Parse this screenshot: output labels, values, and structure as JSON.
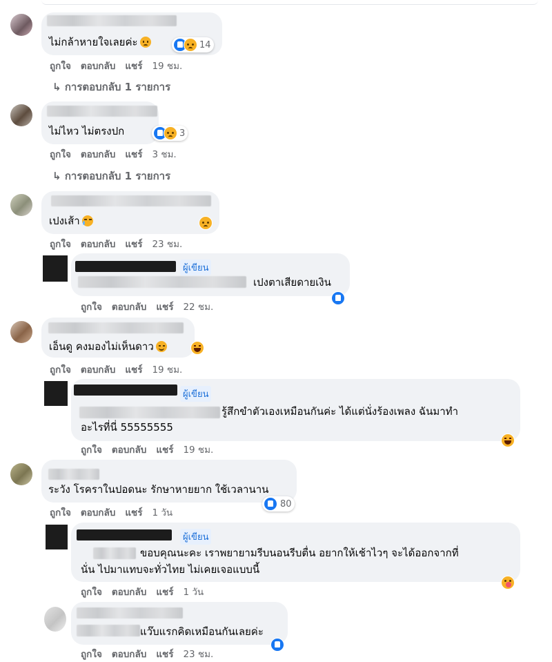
{
  "actions": {
    "like": "ถูกใจ",
    "reply": "ตอบกลับ",
    "share": "แชร์"
  },
  "author_tag": "ผู้เขียน",
  "comments": [
    {
      "text": "ไม่กล้าหายใจเลยค่ะ",
      "reaction_count": "14",
      "time": "19 ชม.",
      "replies": "การตอบกลับ 1 รายการ"
    },
    {
      "text": "ไม่ไหว ไม่ตรงปก",
      "reaction_count": "3",
      "time": "3 ชม.",
      "replies": "การตอบกลับ 1 รายการ"
    },
    {
      "text": "เปงเส้า",
      "time": "23 ชม."
    },
    {
      "text": "เอ็นดู คงมองไม่เห็นดาว",
      "time": "19 ชม."
    },
    {
      "text": "ระวัง โรคราในปอดนะ รักษาหายยาก ใช้เวลานาน",
      "reaction_count": "80",
      "time": "1 วัน"
    },
    {
      "text": "แว๊บแรกคิดเหมือนกันเลยค่ะ",
      "time": "23 ชม."
    }
  ],
  "author_replies": [
    {
      "text": "เปงตาเสียดายเงิน",
      "time": "22 ชม."
    },
    {
      "text_line1": "รู้สึกขำตัวเองเหมือนกันค่ะ ได้แต่นั่งร้องเพลง ฉันมาทำ",
      "text_line2": "อะไรที่นี่ 55555555",
      "time": "19 ชม."
    },
    {
      "text_line1": "ขอบคุณนะคะ เราพยายามรีบนอนรีบตื่น อยากให้เช้าไวๆ จะได้ออกจากที่",
      "text_line2": "นั่น ไปมาแทบจะทั่วไทย ไม่เคยเจอแบบนี้",
      "time": "1 วัน"
    }
  ],
  "colors": {
    "bubble": "#f0f2f5",
    "action_text": "#65676b",
    "author_blue": "#1a6ed8",
    "like_blue": "#1877f2"
  },
  "icons": [
    "like-reaction-icon",
    "sad-reaction-icon",
    "haha-reaction-icon",
    "care-reaction-icon",
    "reply-arrow-icon"
  ]
}
